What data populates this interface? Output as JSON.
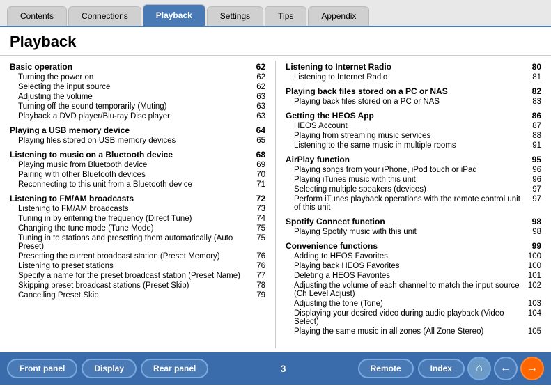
{
  "tabs": [
    {
      "label": "Contents",
      "active": false
    },
    {
      "label": "Connections",
      "active": false
    },
    {
      "label": "Playback",
      "active": true
    },
    {
      "label": "Settings",
      "active": false
    },
    {
      "label": "Tips",
      "active": false
    },
    {
      "label": "Appendix",
      "active": false
    }
  ],
  "page_title": "Playback",
  "left_col": {
    "sections": [
      {
        "title": "Basic operation",
        "page": "62",
        "entries": [
          {
            "text": "Turning the power on",
            "page": "62"
          },
          {
            "text": "Selecting the input source",
            "page": "62"
          },
          {
            "text": "Adjusting the volume",
            "page": "63"
          },
          {
            "text": "Turning off the sound temporarily (Muting)",
            "page": "63"
          },
          {
            "text": "Playback a DVD player/Blu-ray Disc player",
            "page": "63"
          }
        ]
      },
      {
        "title": "Playing a USB memory device",
        "page": "64",
        "entries": [
          {
            "text": "Playing files stored on USB memory devices",
            "page": "65"
          }
        ]
      },
      {
        "title": "Listening to music on a Bluetooth device",
        "page": "68",
        "entries": [
          {
            "text": "Playing music from Bluetooth device",
            "page": "69"
          },
          {
            "text": "Pairing with other Bluetooth devices",
            "page": "70"
          },
          {
            "text": "Reconnecting to this unit from a Bluetooth device",
            "page": "71"
          }
        ]
      },
      {
        "title": "Listening to FM/AM broadcasts",
        "page": "72",
        "entries": [
          {
            "text": "Listening to FM/AM broadcasts",
            "page": "73"
          },
          {
            "text": "Tuning in by entering the frequency (Direct Tune)",
            "page": "74"
          },
          {
            "text": "Changing the tune mode (Tune Mode)",
            "page": "75"
          },
          {
            "text": "Tuning in to stations and presetting them automatically (Auto Preset)",
            "page": "75"
          },
          {
            "text": "Presetting the current broadcast station (Preset Memory)",
            "page": "76"
          },
          {
            "text": "Listening to preset stations",
            "page": "76"
          },
          {
            "text": "Specify a name for the preset broadcast station (Preset Name)",
            "page": "77"
          },
          {
            "text": "Skipping preset broadcast stations (Preset Skip)",
            "page": "78"
          },
          {
            "text": "Cancelling Preset Skip",
            "page": "79"
          }
        ]
      }
    ]
  },
  "right_col": {
    "sections": [
      {
        "title": "Listening to Internet Radio",
        "page": "80",
        "entries": [
          {
            "text": "Listening to Internet Radio",
            "page": "81"
          }
        ]
      },
      {
        "title": "Playing back files stored on a PC or NAS",
        "page": "82",
        "entries": [
          {
            "text": "Playing back files stored on a PC or NAS",
            "page": "83"
          }
        ]
      },
      {
        "title": "Getting the HEOS App",
        "page": "86",
        "entries": [
          {
            "text": "HEOS Account",
            "page": "87"
          },
          {
            "text": "Playing from streaming music services",
            "page": "88"
          },
          {
            "text": "Listening to the same music in multiple rooms",
            "page": "91"
          }
        ]
      },
      {
        "title": "AirPlay function",
        "page": "95",
        "entries": [
          {
            "text": "Playing songs from your iPhone, iPod touch or iPad",
            "page": "96"
          },
          {
            "text": "Playing iTunes music with this unit",
            "page": "96"
          },
          {
            "text": "Selecting multiple speakers (devices)",
            "page": "97"
          },
          {
            "text": "Perform iTunes playback operations with the remote control unit of this unit",
            "page": "97"
          }
        ]
      },
      {
        "title": "Spotify Connect function",
        "page": "98",
        "entries": [
          {
            "text": "Playing Spotify music with this unit",
            "page": "98"
          }
        ]
      },
      {
        "title": "Convenience functions",
        "page": "99",
        "entries": [
          {
            "text": "Adding to HEOS Favorites",
            "page": "100"
          },
          {
            "text": "Playing back HEOS Favorites",
            "page": "100"
          },
          {
            "text": "Deleting a HEOS Favorites",
            "page": "101"
          },
          {
            "text": "Adjusting the volume of each channel to match the input source (Ch Level Adjust)",
            "page": "102"
          },
          {
            "text": "Adjusting the tone (Tone)",
            "page": "103"
          },
          {
            "text": "Displaying your desired video during audio playback (Video Select)",
            "page": "104"
          },
          {
            "text": "Playing the same music in all zones (All Zone Stereo)",
            "page": "105"
          }
        ]
      }
    ]
  },
  "footer": {
    "buttons_left": [
      "Front panel",
      "Display",
      "Rear panel"
    ],
    "page_number": "3",
    "buttons_right": [
      "Remote",
      "Index"
    ]
  }
}
